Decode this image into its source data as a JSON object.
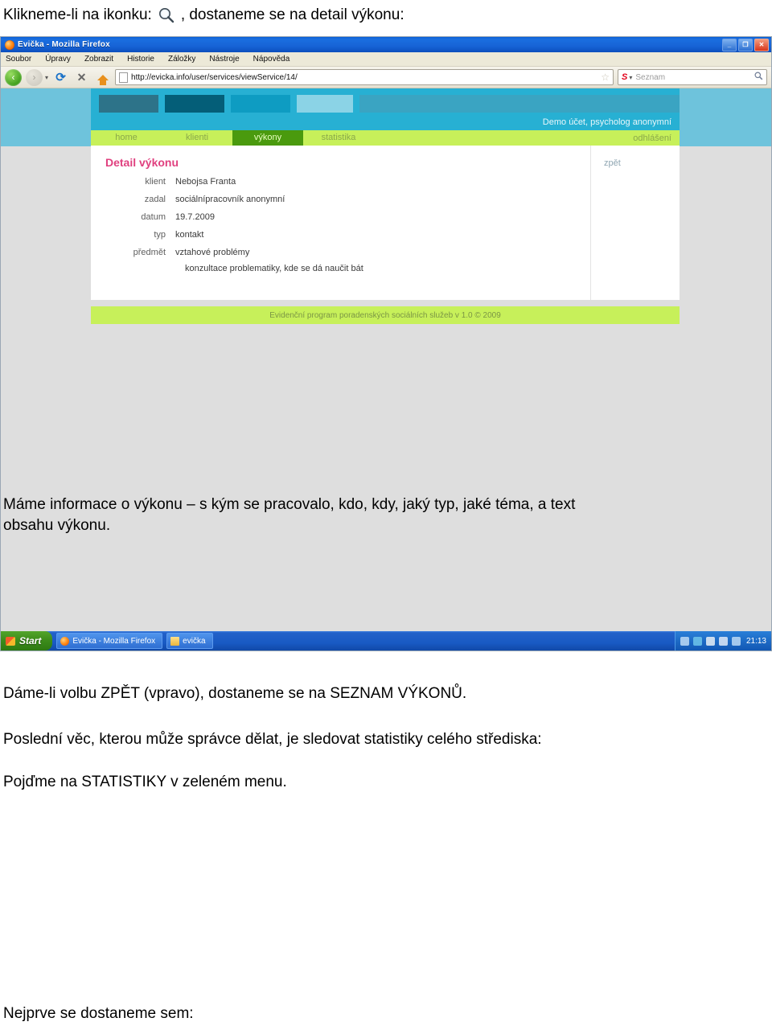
{
  "document": {
    "intro_before": "Klikneme-li na ikonku:",
    "intro_icon": "magnifier-icon",
    "intro_after": ", dostaneme se na detail výkonu:",
    "paragraph_1_line_1": "Máme informace o výkonu – s kým se pracovalo, kdo, kdy, jaký typ, jaké téma, a  text",
    "paragraph_1_line_2": "obsahu výkonu.",
    "paragraph_2": "Dáme-li volbu ZPĚT (vpravo), dostaneme se na SEZNAM VÝKONŮ.",
    "paragraph_3": "Poslední věc, kterou může správce dělat, je sledovat statistiky celého střediska:",
    "paragraph_4": "Pojďme na STATISTIKY v zeleném menu.",
    "paragraph_5": "Nejprve se dostaneme sem:"
  },
  "browser": {
    "window_title": "Evička - Mozilla Firefox",
    "window_buttons": {
      "minimize": "_",
      "maximize": "❐",
      "close": "✕"
    },
    "menu": [
      "Soubor",
      "Úpravy",
      "Zobrazit",
      "Historie",
      "Záložky",
      "Nástroje",
      "Nápověda"
    ],
    "toolbar": {
      "back": "‹",
      "forward": "›",
      "dropdown": "▾",
      "reload": "⟳",
      "stop": "✕",
      "home": "home-icon"
    },
    "url": "http://evicka.info/user/services/viewService/14/",
    "bookmark_star": "☆",
    "search": {
      "engine": "S",
      "placeholder": "Seznam",
      "icon": "search-icon"
    }
  },
  "page": {
    "account": "Demo účet, psycholog anonymní",
    "nav": [
      {
        "label": "home",
        "active": false
      },
      {
        "label": "klienti",
        "active": false
      },
      {
        "label": "výkony",
        "active": true
      },
      {
        "label": "statistika",
        "active": false
      }
    ],
    "logout": "odhlášení",
    "heading": "Detail výkonu",
    "back_link": "zpět",
    "fields": [
      {
        "label": "klient",
        "value": "Nebojsa Franta"
      },
      {
        "label": "zadal",
        "value": "sociálnípracovník anonymní"
      },
      {
        "label": "datum",
        "value": "19.7.2009"
      },
      {
        "label": "typ",
        "value": "kontakt"
      },
      {
        "label": "předmět",
        "value": "vztahové problémy"
      }
    ],
    "note": "konzultace problematiky, kde se dá naučit bát",
    "footer": "Evidenční program poradenských sociálních služeb v 1.0 © 2009",
    "banner_blocks": [
      "#2d7389",
      "#045e78",
      "#0e9cc2",
      "#8bd3e6",
      "#3aa4c2"
    ],
    "colors": {
      "banner": "#27b0d3",
      "band": "#6ec3dc",
      "nav_green": "#c7f05a",
      "nav_active": "#4a9a0e",
      "heading": "#e0407f",
      "page_bg": "#dedede"
    }
  },
  "taskbar": {
    "start": "Start",
    "items": [
      {
        "label": "Evička - Mozilla Firefox",
        "icon": "firefox-icon"
      },
      {
        "label": "evička",
        "icon": "folder-icon"
      }
    ],
    "clock": "21:13"
  }
}
